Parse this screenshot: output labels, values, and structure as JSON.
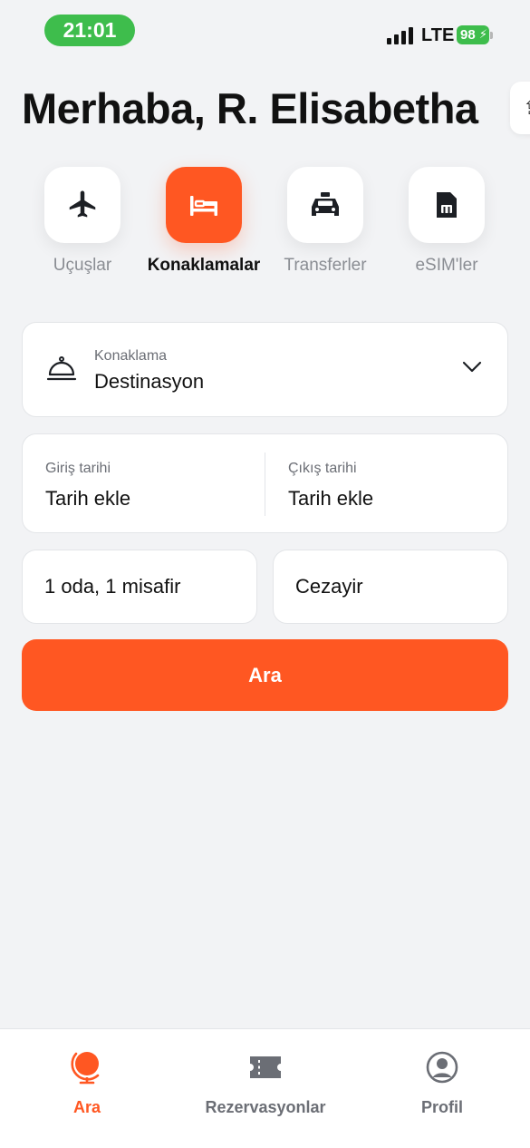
{
  "status_bar": {
    "time": "21:01",
    "network": "LTE",
    "battery": "98",
    "time_pill_color": "#3ebd4c"
  },
  "greeting": "Merhaba, R. Elisabetha",
  "categories": [
    {
      "label": "Uçuşlar",
      "icon": "plane-icon",
      "active": false
    },
    {
      "label": "Konaklamalar",
      "icon": "bed-icon",
      "active": true
    },
    {
      "label": "Transferler",
      "icon": "taxi-icon",
      "active": false
    },
    {
      "label": "eSIM'ler",
      "icon": "sim-card-icon",
      "active": false
    }
  ],
  "search_form": {
    "destination": {
      "label": "Konaklama",
      "value": "Destinasyon",
      "icon": "reception-bell-icon"
    },
    "check_in": {
      "label": "Giriş tarihi",
      "value": "Tarih ekle"
    },
    "check_out": {
      "label": "Çıkış tarihi",
      "value": "Tarih ekle"
    },
    "guests": "1 oda, 1 misafir",
    "country": "Cezayir",
    "search_button": "Ara"
  },
  "bottom_nav": [
    {
      "label": "Ara",
      "icon": "globe-icon",
      "active": true
    },
    {
      "label": "Rezervasyonlar",
      "icon": "ticket-icon",
      "active": false
    },
    {
      "label": "Profil",
      "icon": "profile-icon",
      "active": false
    }
  ],
  "colors": {
    "accent": "#ff5722",
    "background": "#f2f3f5",
    "muted_text": "#8a8d93"
  }
}
